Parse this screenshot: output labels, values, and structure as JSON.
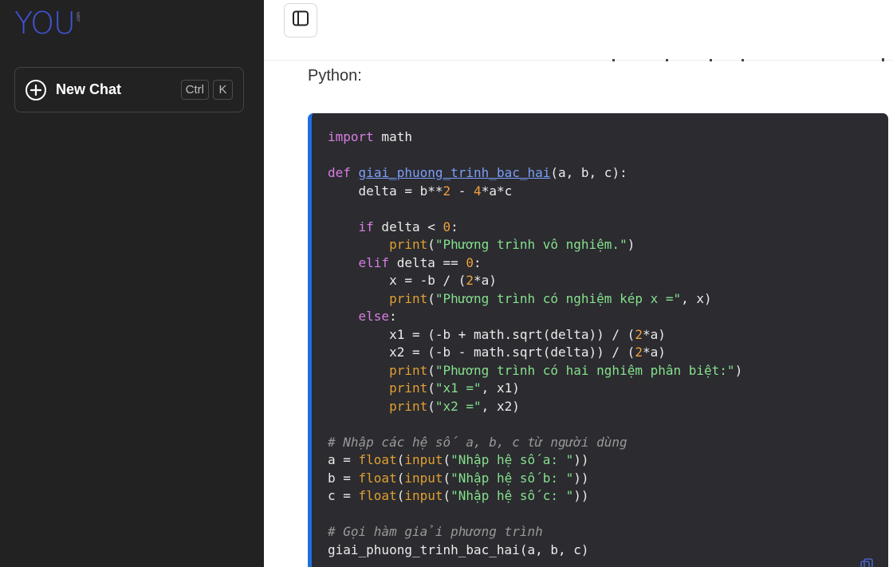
{
  "sidebar": {
    "logo_text": "YOU",
    "logo_sub": ".com",
    "new_chat_label": "New Chat",
    "shortcut": [
      "Ctrl",
      "K"
    ]
  },
  "main": {
    "intro_text": "Python:",
    "code_language": "python",
    "code_lines": [
      [
        {
          "t": "import",
          "c": "kw"
        },
        {
          "t": " math",
          "c": ""
        }
      ],
      [],
      [
        {
          "t": "def",
          "c": "kw"
        },
        {
          "t": " ",
          "c": ""
        },
        {
          "t": "giai_phuong_trinh_bac_hai",
          "c": "fn"
        },
        {
          "t": "(a, b, c):",
          "c": ""
        }
      ],
      [
        {
          "t": "    delta = b**",
          "c": ""
        },
        {
          "t": "2",
          "c": "num"
        },
        {
          "t": " - ",
          "c": ""
        },
        {
          "t": "4",
          "c": "num"
        },
        {
          "t": "*a*c",
          "c": ""
        }
      ],
      [],
      [
        {
          "t": "    ",
          "c": ""
        },
        {
          "t": "if",
          "c": "kw"
        },
        {
          "t": " delta < ",
          "c": ""
        },
        {
          "t": "0",
          "c": "num"
        },
        {
          "t": ":",
          "c": ""
        }
      ],
      [
        {
          "t": "        ",
          "c": ""
        },
        {
          "t": "print",
          "c": "bi"
        },
        {
          "t": "(",
          "c": ""
        },
        {
          "t": "\"Phương trình vô nghiệm.\"",
          "c": "str"
        },
        {
          "t": ")",
          "c": ""
        }
      ],
      [
        {
          "t": "    ",
          "c": ""
        },
        {
          "t": "elif",
          "c": "kw"
        },
        {
          "t": " delta == ",
          "c": ""
        },
        {
          "t": "0",
          "c": "num"
        },
        {
          "t": ":",
          "c": ""
        }
      ],
      [
        {
          "t": "        x = -b / (",
          "c": ""
        },
        {
          "t": "2",
          "c": "num"
        },
        {
          "t": "*a)",
          "c": ""
        }
      ],
      [
        {
          "t": "        ",
          "c": ""
        },
        {
          "t": "print",
          "c": "bi"
        },
        {
          "t": "(",
          "c": ""
        },
        {
          "t": "\"Phương trình có nghiệm kép x =\"",
          "c": "str"
        },
        {
          "t": ", x)",
          "c": ""
        }
      ],
      [
        {
          "t": "    ",
          "c": ""
        },
        {
          "t": "else",
          "c": "kw"
        },
        {
          "t": ":",
          "c": ""
        }
      ],
      [
        {
          "t": "        x1 = (-b + math.sqrt(delta)) / (",
          "c": ""
        },
        {
          "t": "2",
          "c": "num"
        },
        {
          "t": "*a)",
          "c": ""
        }
      ],
      [
        {
          "t": "        x2 = (-b - math.sqrt(delta)) / (",
          "c": ""
        },
        {
          "t": "2",
          "c": "num"
        },
        {
          "t": "*a)",
          "c": ""
        }
      ],
      [
        {
          "t": "        ",
          "c": ""
        },
        {
          "t": "print",
          "c": "bi"
        },
        {
          "t": "(",
          "c": ""
        },
        {
          "t": "\"Phương trình có hai nghiệm phân biệt:\"",
          "c": "str"
        },
        {
          "t": ")",
          "c": ""
        }
      ],
      [
        {
          "t": "        ",
          "c": ""
        },
        {
          "t": "print",
          "c": "bi"
        },
        {
          "t": "(",
          "c": ""
        },
        {
          "t": "\"x1 =\"",
          "c": "str"
        },
        {
          "t": ", x1)",
          "c": ""
        }
      ],
      [
        {
          "t": "        ",
          "c": ""
        },
        {
          "t": "print",
          "c": "bi"
        },
        {
          "t": "(",
          "c": ""
        },
        {
          "t": "\"x2 =\"",
          "c": "str"
        },
        {
          "t": ", x2)",
          "c": ""
        }
      ],
      [],
      [
        {
          "t": "# Nhập các hệ số a, b, c từ người dùng",
          "c": "cmt"
        }
      ],
      [
        {
          "t": "a = ",
          "c": ""
        },
        {
          "t": "float",
          "c": "bi"
        },
        {
          "t": "(",
          "c": ""
        },
        {
          "t": "input",
          "c": "bi"
        },
        {
          "t": "(",
          "c": ""
        },
        {
          "t": "\"Nhập hệ số a: \"",
          "c": "str"
        },
        {
          "t": "))",
          "c": ""
        }
      ],
      [
        {
          "t": "b = ",
          "c": ""
        },
        {
          "t": "float",
          "c": "bi"
        },
        {
          "t": "(",
          "c": ""
        },
        {
          "t": "input",
          "c": "bi"
        },
        {
          "t": "(",
          "c": ""
        },
        {
          "t": "\"Nhập hệ số b: \"",
          "c": "str"
        },
        {
          "t": "))",
          "c": ""
        }
      ],
      [
        {
          "t": "c = ",
          "c": ""
        },
        {
          "t": "float",
          "c": "bi"
        },
        {
          "t": "(",
          "c": ""
        },
        {
          "t": "input",
          "c": "bi"
        },
        {
          "t": "(",
          "c": ""
        },
        {
          "t": "\"Nhập hệ số c: \"",
          "c": "str"
        },
        {
          "t": "))",
          "c": ""
        }
      ],
      [],
      [
        {
          "t": "# Gọi hàm giải phương trình",
          "c": "cmt"
        }
      ],
      [
        {
          "t": "giai_phuong_trinh_bac_hai(a, b, c)",
          "c": ""
        }
      ]
    ]
  },
  "colors": {
    "sidebar_bg": "#222223",
    "logo": "#4154d9",
    "code_bg": "#2b2b30",
    "code_accent": "#1f6fe0"
  },
  "icons": {
    "new_chat": "plus-circle-icon",
    "sidebar_toggle": "sidebar-toggle-icon",
    "copy": "copy-icon"
  }
}
